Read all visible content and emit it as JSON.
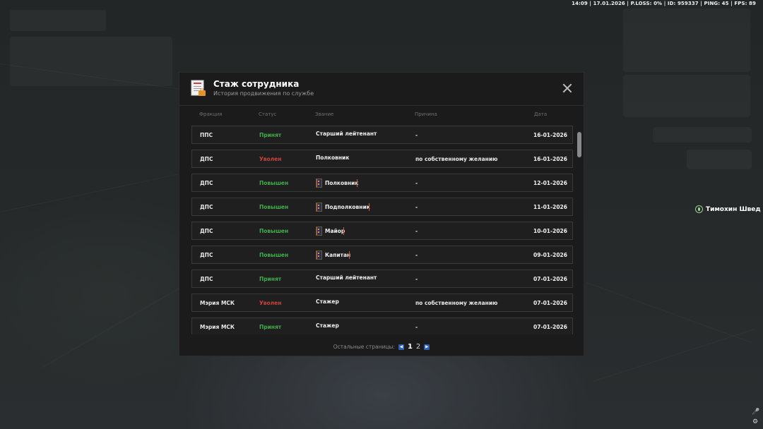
{
  "topbar": "14:09 | 17.01.2026 | P.LOSS: 0% | ID: 959337 | PING: 45 | FPS: 89",
  "npc": {
    "name": "Тимохин Швед",
    "icon": "voice-icon"
  },
  "modal": {
    "title": "Стаж сотрудника",
    "subtitle": "История продвижения по службе",
    "icon": "document-icon",
    "columns": {
      "faction": "Фракция",
      "status": "Статус",
      "rank": "Звание",
      "reason": "Причина",
      "date": "Дата"
    },
    "rows": [
      {
        "faction": "ППС",
        "status": "Принят",
        "status_type": "green",
        "rank": "Старший лейтенант",
        "rank_badge": "",
        "reason": "-",
        "date": "16-01-2026"
      },
      {
        "faction": "ДПС",
        "status": "Уволен",
        "status_type": "red",
        "rank": "Полковник",
        "rank_badge": "",
        "reason": "по собственному желанию",
        "date": "16-01-2026"
      },
      {
        "faction": "ДПС",
        "status": "Повышен",
        "status_type": "green",
        "rank": "Полковник",
        "rank_badge": "colonel",
        "reason": "-",
        "date": "12-01-2026"
      },
      {
        "faction": "ДПС",
        "status": "Повышен",
        "status_type": "green",
        "rank": "Подполковник",
        "rank_badge": "lt-colonel",
        "reason": "-",
        "date": "11-01-2026"
      },
      {
        "faction": "ДПС",
        "status": "Повышен",
        "status_type": "green",
        "rank": "Майор",
        "rank_badge": "major",
        "reason": "-",
        "date": "10-01-2026"
      },
      {
        "faction": "ДПС",
        "status": "Повышен",
        "status_type": "green",
        "rank": "Капитан",
        "rank_badge": "captain",
        "reason": "-",
        "date": "09-01-2026"
      },
      {
        "faction": "ДПС",
        "status": "Принят",
        "status_type": "green",
        "rank": "Старший лейтенант",
        "rank_badge": "",
        "reason": "-",
        "date": "07-01-2026"
      },
      {
        "faction": "Мэрия МСК",
        "status": "Уволен",
        "status_type": "red",
        "rank": "Стажер",
        "rank_badge": "",
        "reason": "по собственному желанию",
        "date": "07-01-2026"
      },
      {
        "faction": "Мэрия МСК",
        "status": "Принят",
        "status_type": "green",
        "rank": "Стажер",
        "rank_badge": "",
        "reason": "-",
        "date": "07-01-2026"
      }
    ],
    "pager": {
      "label": "Остальные страницы:",
      "pages": [
        "1",
        "2"
      ],
      "current": "1"
    }
  },
  "colors": {
    "green": "#3fae4a",
    "red": "#c8443c",
    "accent": "#2f5db0"
  }
}
